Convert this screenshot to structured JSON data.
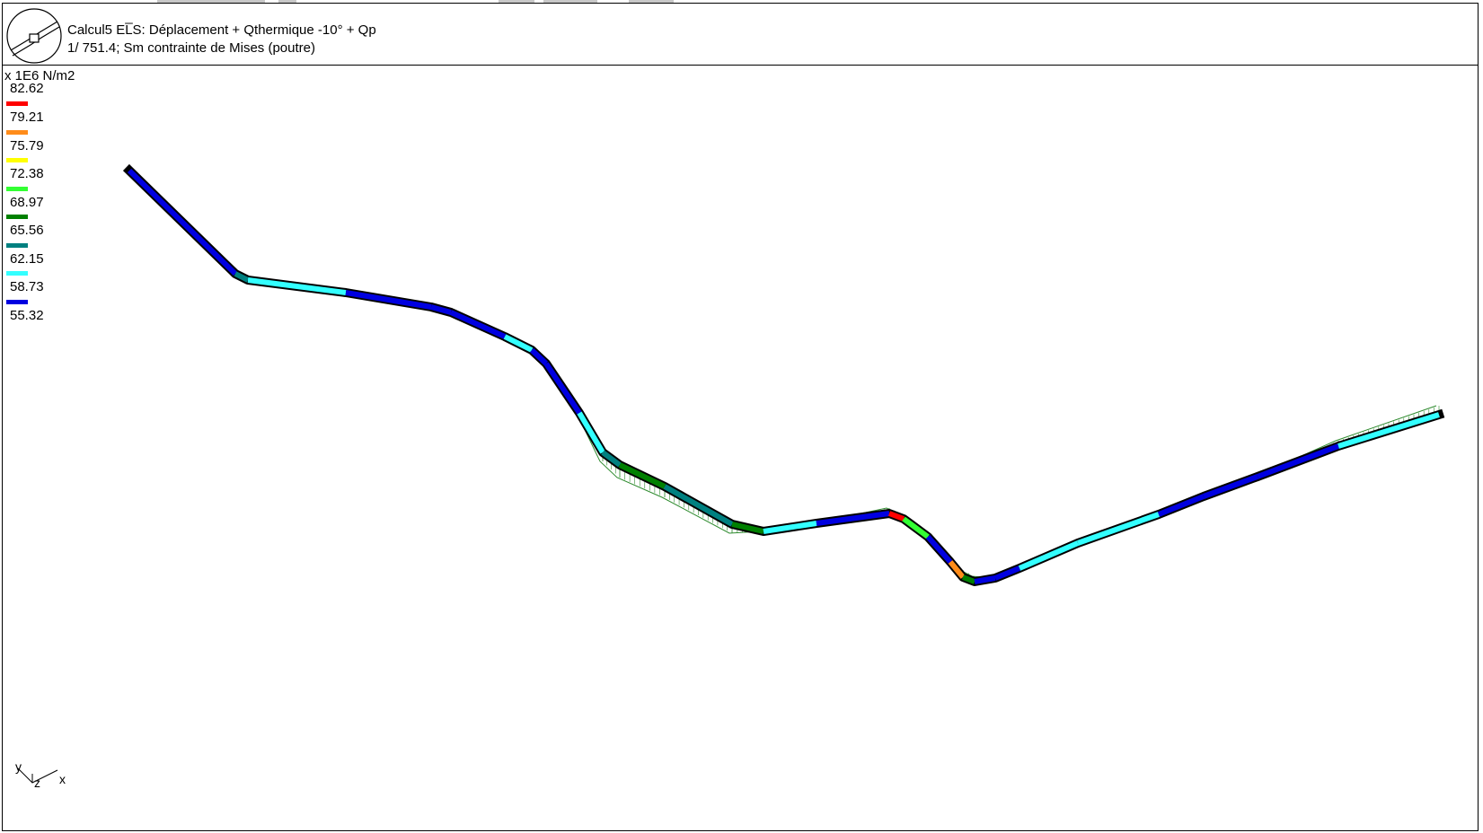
{
  "header": {
    "line1": "Calcul5 EL̅S: Déplacement + Qthermique -10° + Qp",
    "line2": "1/ 751.4; Sm  contrainte de Mises (poutre)"
  },
  "legend": {
    "unit": "x 1E6 N/m2",
    "top_value": "82.62",
    "levels": [
      {
        "label": "79.21",
        "color": "#ff0000"
      },
      {
        "label": "75.79",
        "color": "#ff8c1a"
      },
      {
        "label": "72.38",
        "color": "#ffff00"
      },
      {
        "label": "68.97",
        "color": "#33ff33"
      },
      {
        "label": "65.56",
        "color": "#008000"
      },
      {
        "label": "62.15",
        "color": "#008080"
      },
      {
        "label": "58.73",
        "color": "#33ffff"
      },
      {
        "label": "55.32",
        "color": "#0000e0"
      }
    ]
  },
  "axes": {
    "y": "y",
    "z": "z",
    "x": "x"
  },
  "colors": {
    "outline": "#000000",
    "deformed_shape": "#2e8b2e",
    "blue": "#0000e0",
    "cyan": "#33ffff",
    "teal": "#008080",
    "dark_green": "#008000",
    "green": "#33ff33",
    "yellow": "#ffff00",
    "orange": "#ff8c1a",
    "red": "#ff0000"
  },
  "icons": {
    "logo": "beam-profile-logo-icon"
  }
}
